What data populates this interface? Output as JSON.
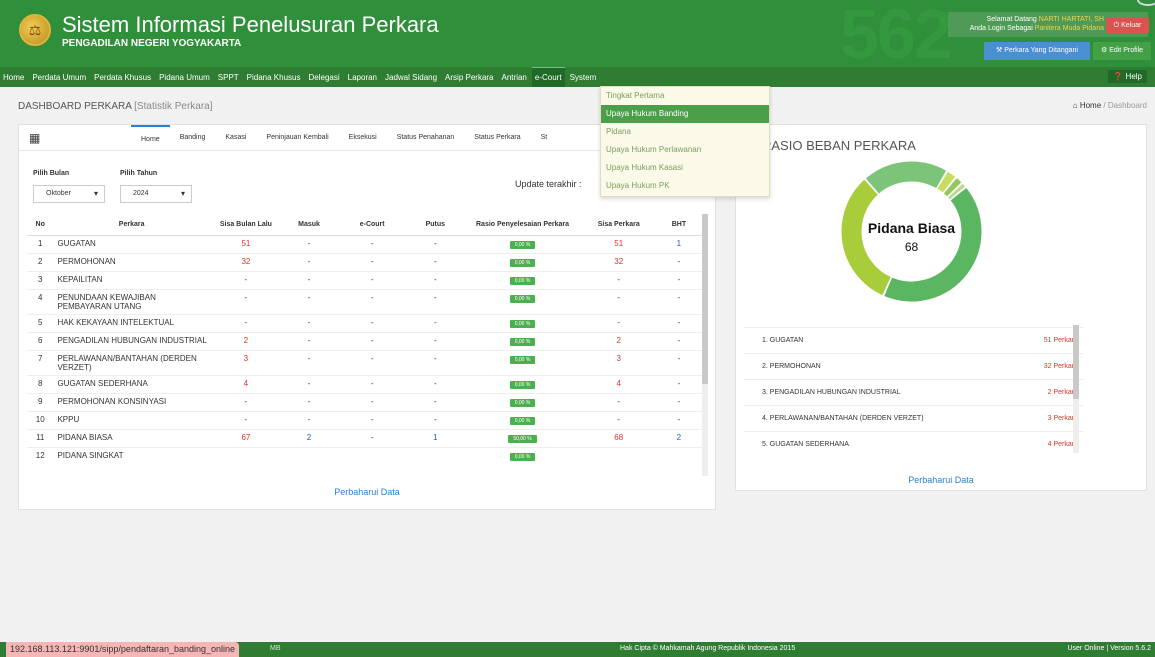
{
  "header": {
    "title": "Sistem Informasi Penelusuran Perkara",
    "subtitle": "PENGADILAN NEGERI YOGYAKARTA",
    "bg_number": "562",
    "welcome_prefix": "Selamat Datang",
    "welcome_name": "NARTI HARTATI, SH",
    "login_prefix": "Anda Login Sebagai",
    "login_role": "Panitera Muda Pidana",
    "logout_label": "Keluar",
    "cases_button": "Perkara Yang Ditangani",
    "edit_profile": "Edit Profile"
  },
  "nav": {
    "items": [
      "Home",
      "Perdata Umum",
      "Perdata Khusus",
      "Pidana Umum",
      "SPPT",
      "Pidana Khusus",
      "Delegasi",
      "Laporan",
      "Jadwal Sidang",
      "Arsip Perkara",
      "Antrian",
      "e-Court",
      "System"
    ],
    "active": "e-Court",
    "help": "Help"
  },
  "dropdown": {
    "items": [
      "Tingkat Pertama",
      "Upaya Hukum Banding",
      "Pidana",
      "Upaya Hukum Perlawanan",
      "Upaya Hukum Kasasi",
      "Upaya Hukum PK"
    ],
    "highlighted": "Upaya Hukum Banding"
  },
  "page": {
    "title": "DASHBOARD PERKARA",
    "subtitle": "[Statistik Perkara]",
    "crumb_home": "Home",
    "crumb_current": "Dashboard"
  },
  "tabs": [
    "Home",
    "Banding",
    "Kasasi",
    "Peninjauan Kembali",
    "Eksekusi",
    "Status Penahanan",
    "Status Perkara",
    "St"
  ],
  "filters": {
    "month_label": "Pilih Bulan",
    "month_value": "Oktober",
    "year_label": "Pilih Tahun",
    "year_value": "2024",
    "update_text": "Update terakhir :"
  },
  "table": {
    "headers": [
      "No",
      "Perkara",
      "Sisa Bulan Lalu",
      "Masuk",
      "e-Court",
      "Putus",
      "Rasio Penyelesaian Perkara",
      "Sisa Perkara",
      "BHT"
    ],
    "rows": [
      [
        "1",
        "GUGATAN",
        "51",
        "-",
        "-",
        "-",
        "0,00 %",
        "51",
        "1"
      ],
      [
        "2",
        "PERMOHONAN",
        "32",
        "-",
        "-",
        "-",
        "0,00 %",
        "32",
        "-"
      ],
      [
        "3",
        "KEPAILITAN",
        "-",
        "-",
        "-",
        "-",
        "0,00 %",
        "-",
        "-"
      ],
      [
        "4",
        "PENUNDAAN KEWAJIBAN PEMBAYARAN UTANG",
        "-",
        "-",
        "-",
        "-",
        "0,00 %",
        "-",
        "-"
      ],
      [
        "5",
        "HAK KEKAYAAN INTELEKTUAL",
        "-",
        "-",
        "-",
        "-",
        "0,00 %",
        "-",
        "-"
      ],
      [
        "6",
        "PENGADILAN HUBUNGAN INDUSTRIAL",
        "2",
        "-",
        "-",
        "-",
        "0,00 %",
        "2",
        "-"
      ],
      [
        "7",
        "PERLAWANAN/BANTAHAN (DERDEN VERZET)",
        "3",
        "-",
        "-",
        "-",
        "0,00 %",
        "3",
        "-"
      ],
      [
        "8",
        "GUGATAN SEDERHANA",
        "4",
        "-",
        "-",
        "-",
        "0,00 %",
        "4",
        "-"
      ],
      [
        "9",
        "PERMOHONAN KONSINYASI",
        "-",
        "-",
        "-",
        "-",
        "0,00 %",
        "-",
        "-"
      ],
      [
        "10",
        "KPPU",
        "-",
        "-",
        "-",
        "-",
        "0,00 %",
        "-",
        "-"
      ],
      [
        "11",
        "PIDANA BIASA",
        "67",
        "2",
        "-",
        "1",
        "50,00 %",
        "68",
        "2"
      ],
      [
        "12",
        "PIDANA SINGKAT",
        "",
        "",
        "",
        "",
        "0,00 %",
        "",
        ""
      ]
    ],
    "refresh_label": "Perbaharui Data"
  },
  "ratio": {
    "title": "RASIO BEBAN PERKARA",
    "center_label": "Pidana Biasa",
    "center_value": "68",
    "list": [
      {
        "name": "1. GUGATAN",
        "count": "51 Perkara"
      },
      {
        "name": "2. PERMOHONAN",
        "count": "32 Perkara"
      },
      {
        "name": "3. PENGADILAN HUBUNGAN INDUSTRIAL",
        "count": "2 Perkara"
      },
      {
        "name": "4. PERLAWANAN/BANTAHAN (DERDEN VERZET)",
        "count": "3 Perkara"
      },
      {
        "name": "5. GUGATAN SEDERHANA",
        "count": "4 Perkara"
      }
    ],
    "refresh_label": "Perbaharui Data",
    "segments": [
      {
        "value": 68,
        "color": "#5bb661"
      },
      {
        "value": 51,
        "color": "#a8cc3a"
      },
      {
        "value": 32,
        "color": "#7cc47a"
      },
      {
        "value": 4,
        "color": "#c9dc62"
      },
      {
        "value": 3,
        "color": "#93c95c"
      },
      {
        "value": 2,
        "color": "#b8d98b"
      }
    ]
  },
  "footer": {
    "url": "192.168.113.121:9901/sipp/pendaftaran_banding_online",
    "extra": "MB",
    "copyright": "Hak Cipta © Mahkamah Agung Republik Indonesia 2015",
    "version": "User Online | Version 5.6.2"
  }
}
